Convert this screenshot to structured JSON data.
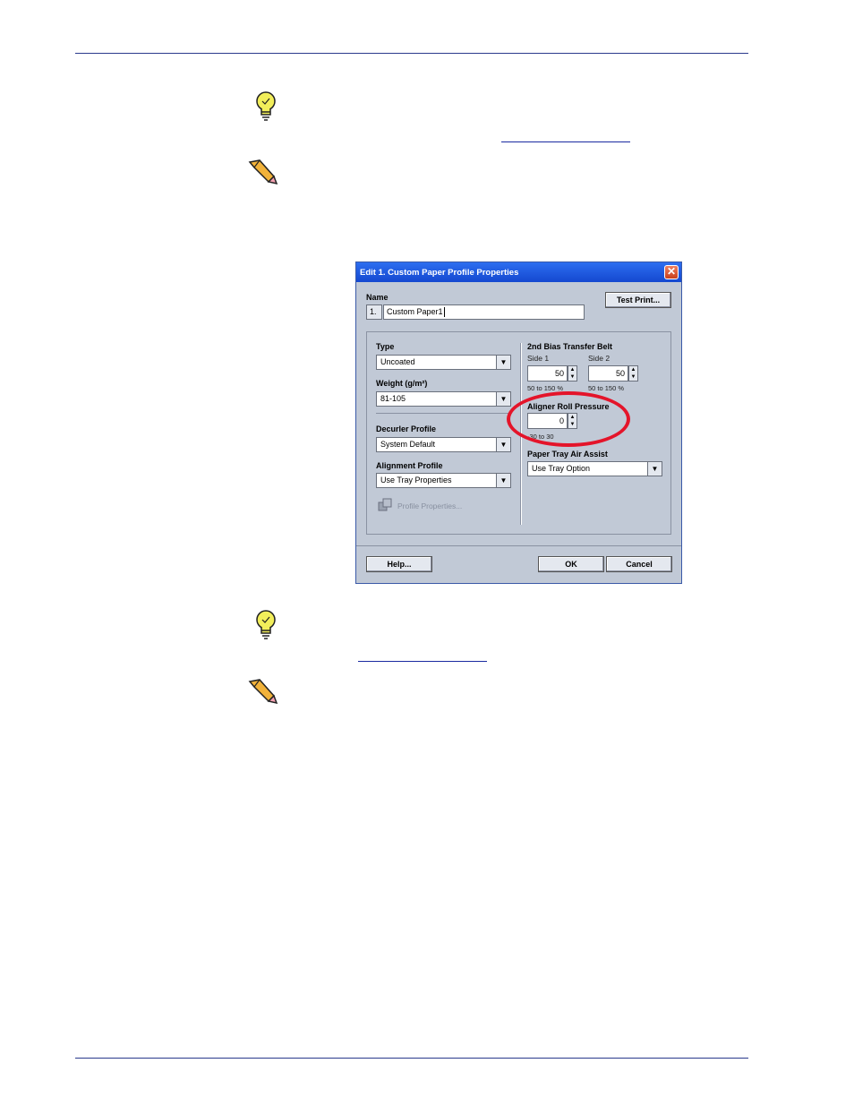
{
  "dialog": {
    "title": "Edit 1. Custom Paper Profile Properties",
    "close_glyph": "✕",
    "name_label": "Name",
    "name_index": "1.",
    "name_value": "Custom Paper1",
    "test_print_label": "Test Print...",
    "type_label": "Type",
    "type_value": "Uncoated",
    "weight_label": "Weight (g/m²)",
    "weight_value": "81-105",
    "decurler_label": "Decurler Profile",
    "decurler_value": "System Default",
    "alignment_label": "Alignment Profile",
    "alignment_value": "Use Tray Properties",
    "profile_properties_label": "Profile Properties...",
    "bias_label": "2nd Bias Transfer Belt",
    "side1_label": "Side 1",
    "side1_value": "50",
    "side1_range": "50 to 150 %",
    "side2_label": "Side 2",
    "side2_value": "50",
    "side2_range": "50 to 150 %",
    "aligner_label": "Aligner Roll Pressure",
    "aligner_value": "0",
    "aligner_range": "-30 to 30",
    "air_assist_label": "Paper Tray Air Assist",
    "air_assist_value": "Use Tray Option",
    "help_label": "Help...",
    "ok_label": "OK",
    "cancel_label": "Cancel"
  },
  "colors": {
    "rule": "#2a3a8c",
    "highlight_circle": "#e4142a"
  },
  "icons": {
    "tip": "lightbulb-icon",
    "note": "pencil-icon",
    "dropdown": "chevron-down-icon",
    "spin_up": "arrow-up-icon",
    "spin_down": "arrow-down-icon"
  }
}
